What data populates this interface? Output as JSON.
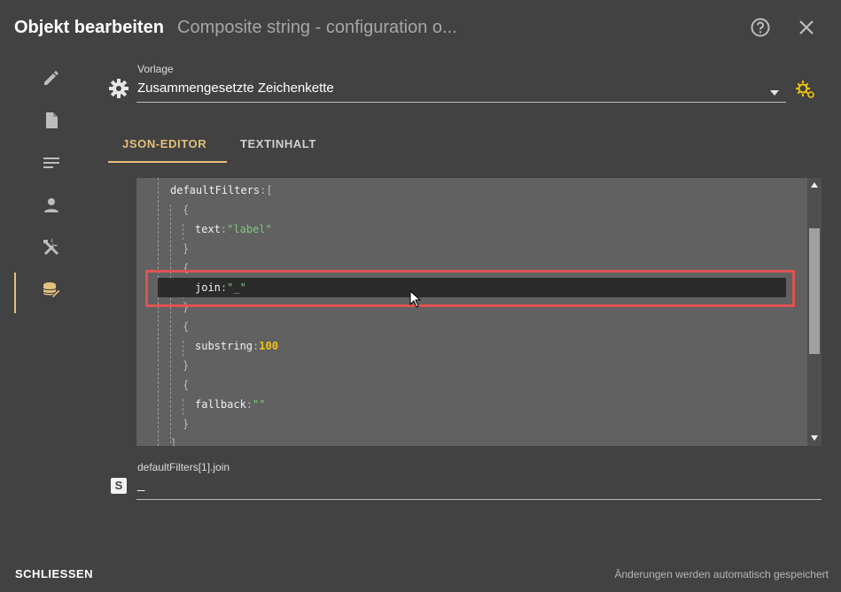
{
  "header": {
    "title": "Objekt bearbeiten",
    "subtitle": "Composite string - configuration o..."
  },
  "template": {
    "label": "Vorlage",
    "value": "Zusammengesetzte Zeichenkette"
  },
  "tabs": [
    {
      "label": "JSON-EDITOR",
      "active": true
    },
    {
      "label": "TEXTINHALT",
      "active": false
    }
  ],
  "editor": {
    "lines": [
      {
        "indent": 0,
        "tokens": [
          {
            "t": "defaultFilters",
            "c": "key"
          },
          {
            "t": ":[",
            "c": "brace"
          }
        ]
      },
      {
        "indent": 1,
        "tokens": [
          {
            "t": "{",
            "c": "brace"
          }
        ]
      },
      {
        "indent": 2,
        "tokens": [
          {
            "t": "text",
            "c": "key"
          },
          {
            "t": ":",
            "c": "brace"
          },
          {
            "t": "\"label\"",
            "c": "str"
          }
        ]
      },
      {
        "indent": 1,
        "tokens": [
          {
            "t": "}",
            "c": "brace"
          }
        ]
      },
      {
        "indent": 1,
        "tokens": [
          {
            "t": "{",
            "c": "brace"
          }
        ]
      },
      {
        "indent": 2,
        "tokens": [
          {
            "t": "join",
            "c": "key"
          },
          {
            "t": ":",
            "c": "brace"
          },
          {
            "t": "\"_\"",
            "c": "str"
          }
        ]
      },
      {
        "indent": 1,
        "tokens": [
          {
            "t": "}",
            "c": "brace"
          }
        ]
      },
      {
        "indent": 1,
        "tokens": [
          {
            "t": "{",
            "c": "brace"
          }
        ]
      },
      {
        "indent": 2,
        "tokens": [
          {
            "t": "substring",
            "c": "key"
          },
          {
            "t": ":",
            "c": "brace"
          },
          {
            "t": "100",
            "c": "num"
          }
        ]
      },
      {
        "indent": 1,
        "tokens": [
          {
            "t": "}",
            "c": "brace"
          }
        ]
      },
      {
        "indent": 1,
        "tokens": [
          {
            "t": "{",
            "c": "brace"
          }
        ]
      },
      {
        "indent": 2,
        "tokens": [
          {
            "t": "fallback",
            "c": "key"
          },
          {
            "t": ":",
            "c": "brace"
          },
          {
            "t": "\"\"",
            "c": "str"
          }
        ]
      },
      {
        "indent": 1,
        "tokens": [
          {
            "t": "}",
            "c": "brace"
          }
        ]
      },
      {
        "indent": 0,
        "tokens": [
          {
            "t": "]",
            "c": "brace"
          }
        ]
      }
    ],
    "highlighted_line": 5
  },
  "field": {
    "path_label": "defaultFilters[1].join",
    "type_badge": "S",
    "value": "_"
  },
  "footer": {
    "close_label": "SCHLIESSEN",
    "autosave_text": "Änderungen werden automatisch gespeichert"
  },
  "colors": {
    "accent": "#e5c07b",
    "highlight_border": "#e05252",
    "string": "#7ec97e",
    "number": "#f1c40f"
  },
  "icons": {
    "help": "help-circle-icon",
    "close": "close-icon",
    "settings": "gear-icon",
    "template_settings": "cog-settings-icon"
  }
}
